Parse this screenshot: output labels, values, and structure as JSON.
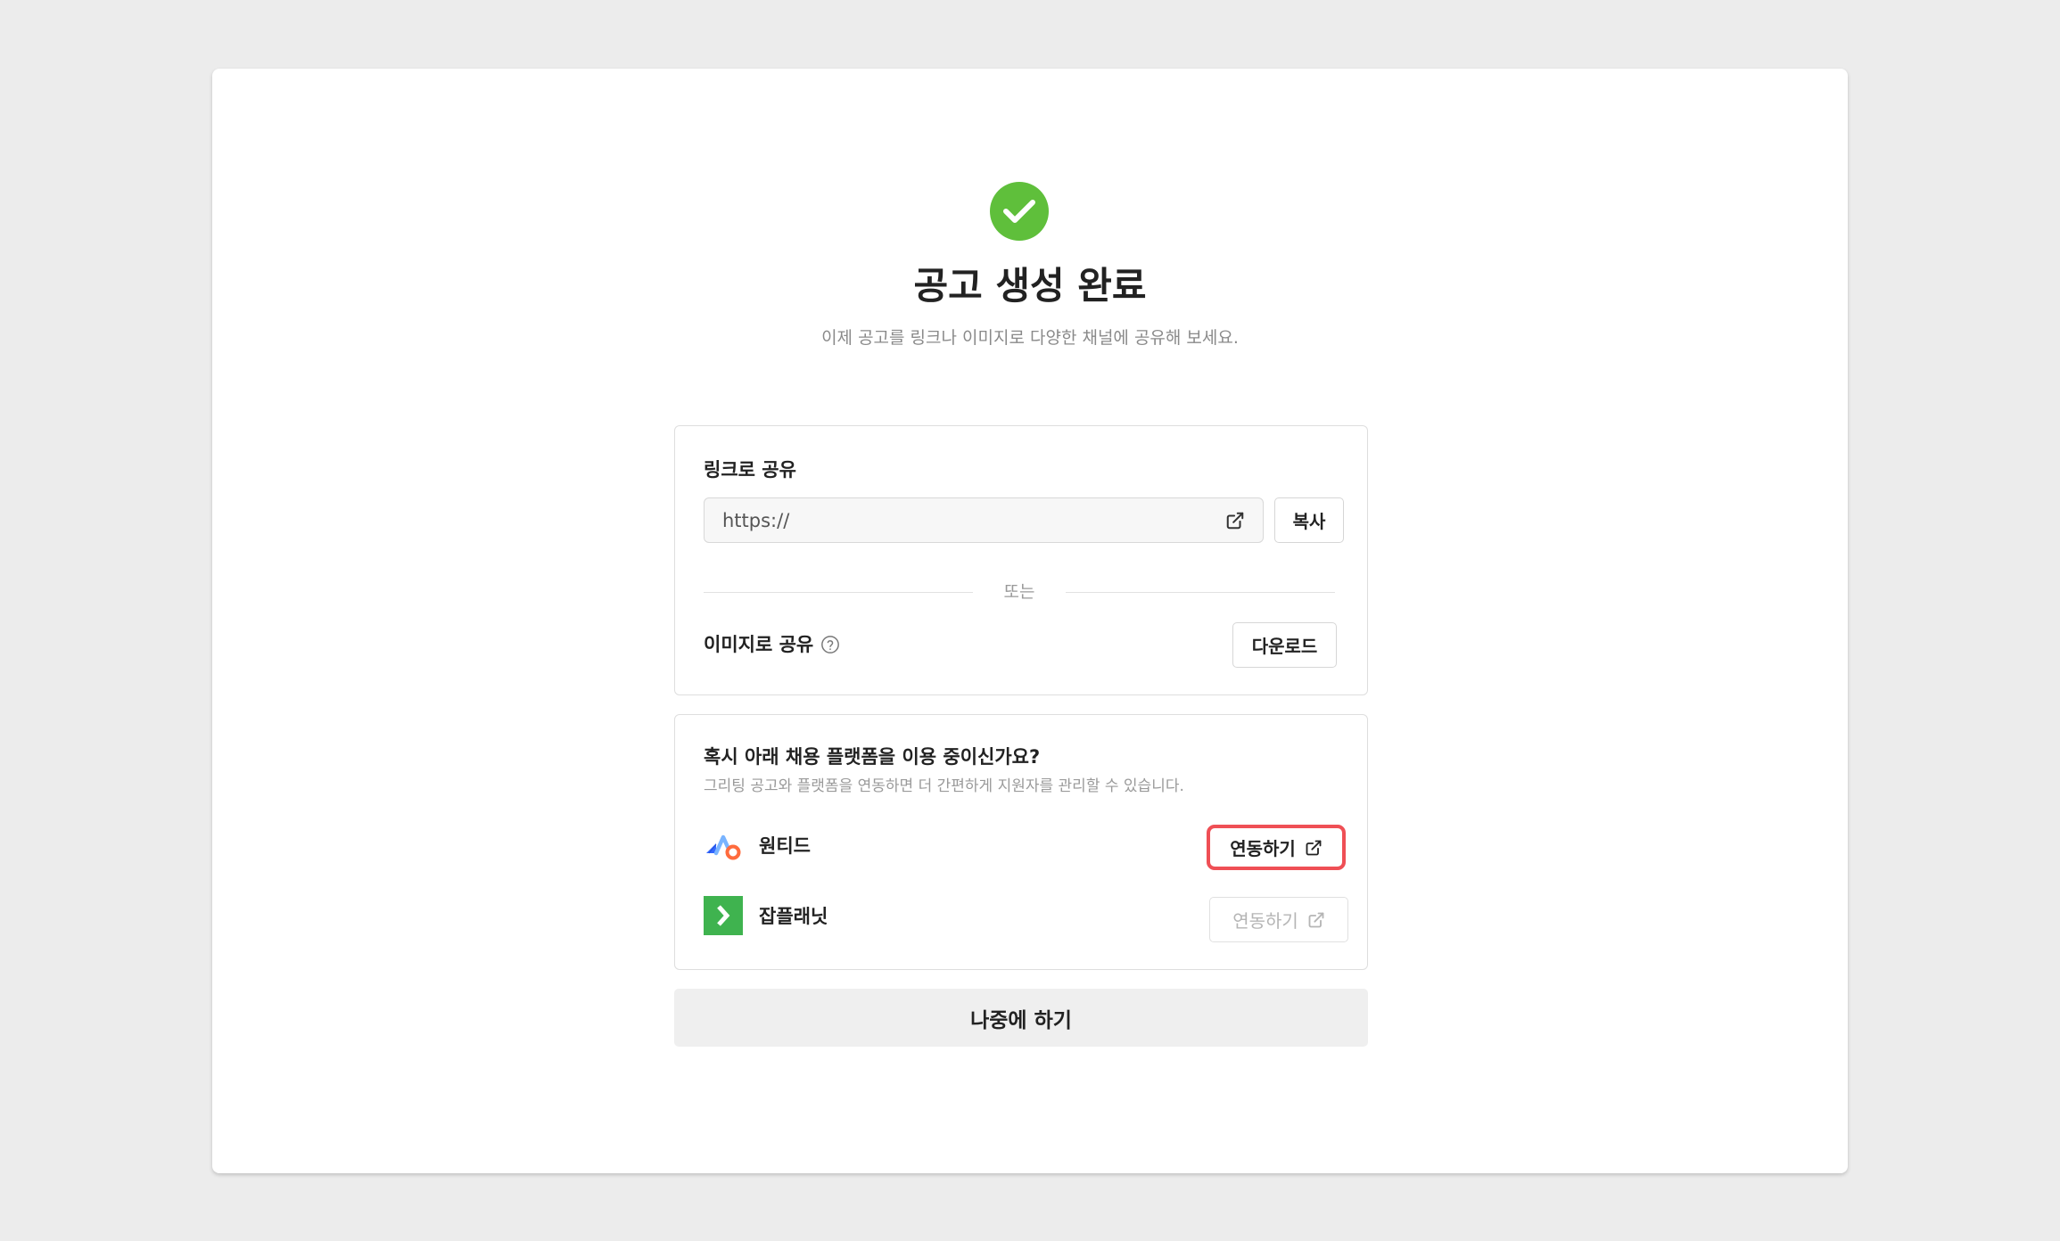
{
  "header": {
    "title": "공고 생성 완료",
    "subtitle": "이제 공고를 링크나 이미지로 다양한 채널에 공유해 보세요."
  },
  "link_share": {
    "label": "링크로 공유",
    "url_value": "https://",
    "copy_label": "복사",
    "or_text": "또는"
  },
  "image_share": {
    "label": "이미지로 공유",
    "download_label": "다운로드"
  },
  "platforms": {
    "question": "혹시 아래 채용 플랫폼을 이용 중이신가요?",
    "description": "그리팅 공고와 플랫폼을 연동하면 더 간편하게 지원자를 관리할 수 있습니다.",
    "items": [
      {
        "name": "원티드",
        "connect_label": "연동하기",
        "icon": "wanted-logo-icon"
      },
      {
        "name": "잡플래닛",
        "connect_label": "연동하기",
        "icon": "jobplanet-logo-icon"
      }
    ]
  },
  "later_label": "나중에 하기",
  "colors": {
    "success_green": "#5fbf3b",
    "highlight_red": "#ef4f55",
    "jobplanet_green": "#3fb34f",
    "background": "#ececec"
  }
}
